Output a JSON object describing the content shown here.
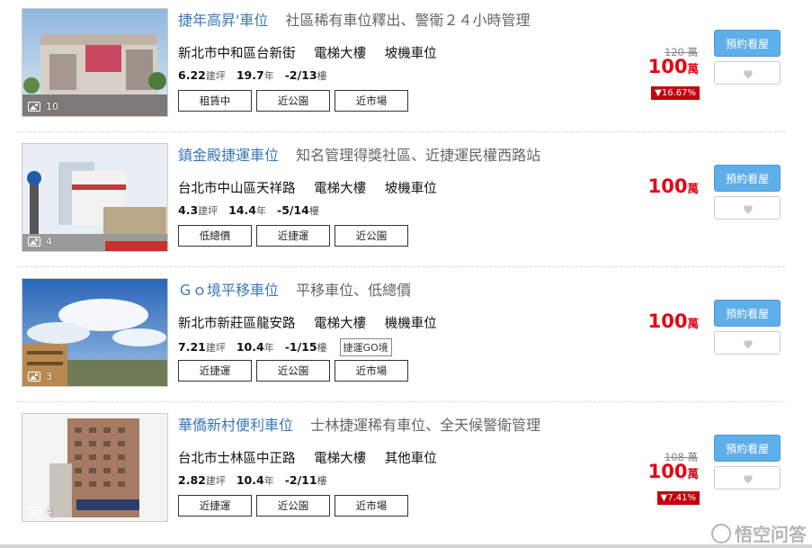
{
  "listings": [
    {
      "title": "捷年高昇'車位",
      "desc": "社區稀有車位釋出、警衛２４小時管理",
      "address": "新北市中和區台新街",
      "building": "電梯大樓",
      "parking": "坡機車位",
      "area": "6.22",
      "area_unit": "建坪",
      "age": "19.7",
      "age_unit": "年",
      "floor": "-2/13",
      "floor_unit": "樓",
      "extra_tag": "",
      "tags": [
        "租賃中",
        "近公園",
        "近市場"
      ],
      "photo_count": "10",
      "old_price": "120 萬",
      "price": "100",
      "price_unit": "萬",
      "drop": "▼16.67%"
    },
    {
      "title": "鎮金殿捷運車位",
      "desc": "知名管理得獎社區、近捷運民權西路站",
      "address": "台北市中山區天祥路",
      "building": "電梯大樓",
      "parking": "坡機車位",
      "area": "4.3",
      "area_unit": "建坪",
      "age": "14.4",
      "age_unit": "年",
      "floor": "-5/14",
      "floor_unit": "樓",
      "extra_tag": "",
      "tags": [
        "低總價",
        "近捷運",
        "近公園"
      ],
      "photo_count": "4",
      "old_price": "",
      "price": "100",
      "price_unit": "萬",
      "drop": ""
    },
    {
      "title": "Ｇｏ境平移車位",
      "desc": "平移車位、低總價",
      "address": "新北市新莊區龍安路",
      "building": "電梯大樓",
      "parking": "機機車位",
      "area": "7.21",
      "area_unit": "建坪",
      "age": "10.4",
      "age_unit": "年",
      "floor": "-1/15",
      "floor_unit": "樓",
      "extra_tag": "捷運GO境",
      "tags": [
        "近捷運",
        "近公園",
        "近市場"
      ],
      "photo_count": "3",
      "old_price": "",
      "price": "100",
      "price_unit": "萬",
      "drop": ""
    },
    {
      "title": "華僑新村便利車位",
      "desc": "士林捷運稀有車位、全天候警衛管理",
      "address": "台北市士林區中正路",
      "building": "電梯大樓",
      "parking": "其他車位",
      "area": "2.82",
      "area_unit": "建坪",
      "age": "10.4",
      "age_unit": "年",
      "floor": "-2/11",
      "floor_unit": "樓",
      "extra_tag": "",
      "tags": [
        "近捷運",
        "近公園",
        "近市場"
      ],
      "photo_count": "4",
      "old_price": "108 萬",
      "price": "100",
      "price_unit": "萬",
      "drop": "▼7.41%"
    }
  ],
  "book_label": "預約看屋",
  "watermark": "悟空问答",
  "colors": {
    "title_link": "#3a77b8",
    "price_red": "#e60012",
    "book_btn": "#5eaee9",
    "drop_badge": "#c7000b"
  }
}
